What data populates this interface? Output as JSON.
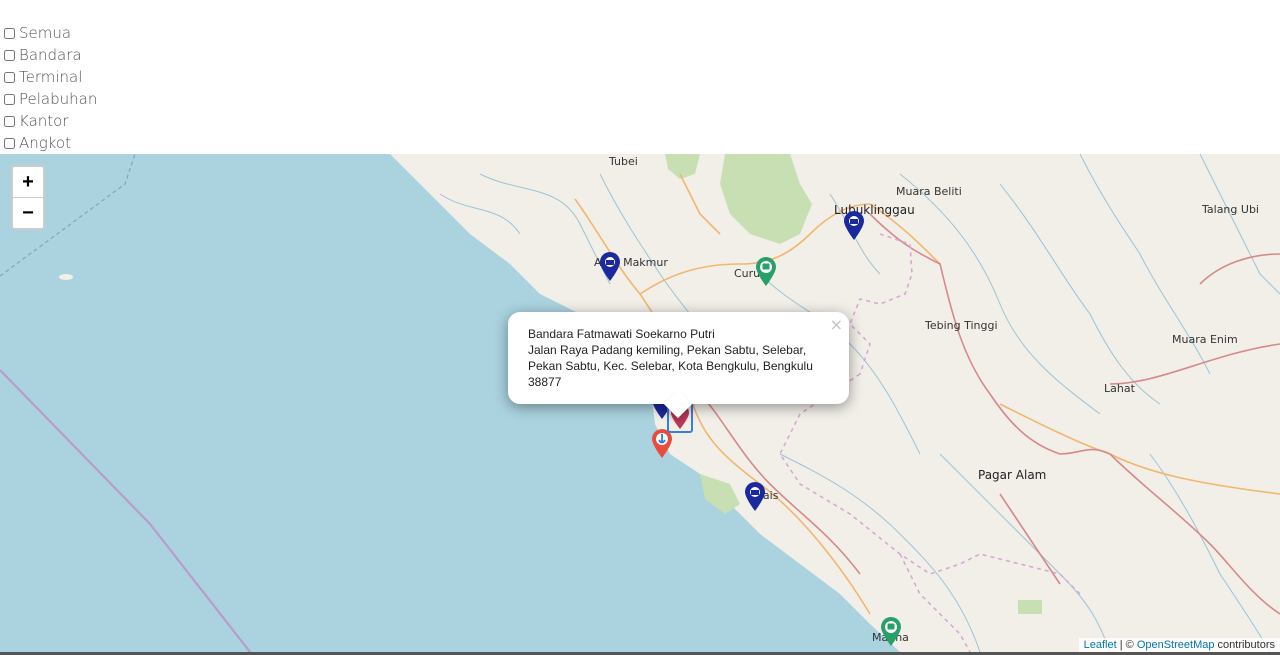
{
  "filters": {
    "items": [
      {
        "label": "Semua",
        "checked": false
      },
      {
        "label": "Bandara",
        "checked": false
      },
      {
        "label": "Terminal",
        "checked": false
      },
      {
        "label": "Pelabuhan",
        "checked": false
      },
      {
        "label": "Kantor",
        "checked": false
      },
      {
        "label": "Angkot",
        "checked": false
      }
    ]
  },
  "zoom": {
    "in_label": "+",
    "out_label": "−"
  },
  "places": {
    "tubei": "Tubei",
    "lubuklinggau": "Lubuklinggau",
    "muara_beliti": "Muara Beliti",
    "talang_ubi": "Talang Ubi",
    "argamakmur": "Arga Makmur",
    "curup": "Curup",
    "tebing_tinggi": "Tebing Tinggi",
    "muara_enim": "Muara Enim",
    "lahat": "Lahat",
    "pagar_alam": "Pagar Alam",
    "manna": "Manna",
    "tais": "Tais"
  },
  "popup": {
    "name": "Bandara Fatmawati Soekarno Putri",
    "address": "Jalan Raya Padang kemiling, Pekan Sabtu, Selebar, Pekan Sabtu, Kec. Selebar, Kota Bengkulu, Bengkulu 38877",
    "close": "×"
  },
  "attribution": {
    "leaflet": "Leaflet",
    "separator": " | © ",
    "osm": "OpenStreetMap",
    "suffix": " contributors"
  },
  "colors": {
    "sea": "#aad3df",
    "land": "#f2efe9",
    "marker_blue": "#1a2a9e",
    "marker_green": "#27a06a",
    "marker_red": "#e74c3c"
  }
}
